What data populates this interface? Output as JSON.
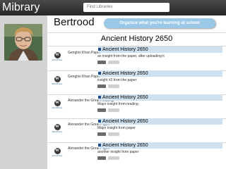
{
  "app": {
    "title": "Mibrary"
  },
  "search": {
    "placeholder": "Find Libraries"
  },
  "user": {
    "name": "Bertrood"
  },
  "tagline": "Organize what you're learning at school",
  "course": {
    "title": "Ancient History 2650"
  },
  "feed": [
    {
      "author": "Genghis Khan Paper",
      "title": "Ancient History 2650",
      "text": "an insight from the paper, after uploading it",
      "source": "WordPress"
    },
    {
      "author": "Genghis Khan Paper",
      "title": "Ancient History 2650",
      "text": "insight #2 from the paper",
      "source": "WordPress"
    },
    {
      "author": "Alexander the Great Reading",
      "title": "Ancient History 2650",
      "text": "Major insight from reading",
      "source": "WordPress"
    },
    {
      "author": "Alexander the Great Paper",
      "title": "Ancient History 2650",
      "text": "Major insight from paper",
      "source": "WordPress"
    },
    {
      "author": "Alexander the Great Paper",
      "title": "Ancient History 2650",
      "text": "another insight from paper",
      "source": "WordPress"
    }
  ],
  "icons": {
    "wordpress": "wordpress-logo-icon",
    "post": "post-square-icon",
    "like": "like-badge-icon",
    "comment": "comment-badge-icon"
  },
  "colors": {
    "topbar": "#333333",
    "sidebar": "#d3d3d3",
    "tagline_bg": "#9bc8e6",
    "post_title_bg": "#cfe0ee",
    "square_icon": "#1f4d88"
  }
}
